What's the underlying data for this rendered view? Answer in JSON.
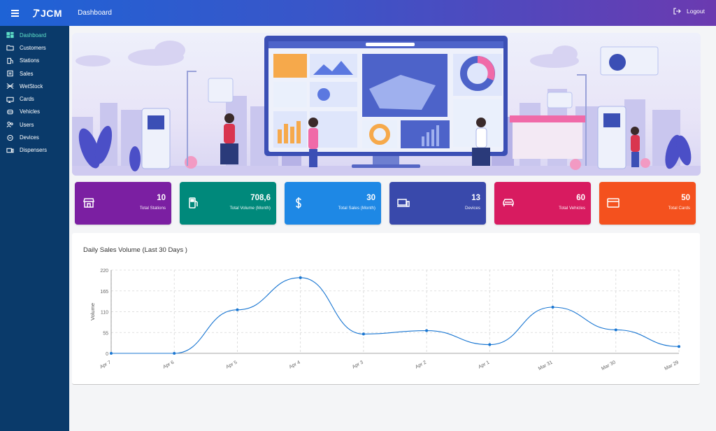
{
  "app": {
    "logo_text": "JCM",
    "page_title": "Dashboard",
    "logout_label": "Logout"
  },
  "sidebar": {
    "items": [
      {
        "label": "Dashboard",
        "icon": "dashboard-icon",
        "active": true
      },
      {
        "label": "Customers",
        "icon": "folder-icon"
      },
      {
        "label": "Stations",
        "icon": "fuel-station-icon"
      },
      {
        "label": "Sales",
        "icon": "receipt-icon"
      },
      {
        "label": "WetStock",
        "icon": "tank-icon"
      },
      {
        "label": "Cards",
        "icon": "card-icon"
      },
      {
        "label": "Vehicles",
        "icon": "vehicle-icon"
      },
      {
        "label": "Users",
        "icon": "users-icon"
      },
      {
        "label": "Devices",
        "icon": "devices-icon"
      },
      {
        "label": "Dispensers",
        "icon": "dispenser-icon"
      }
    ]
  },
  "stats": [
    {
      "value": "10",
      "label": "Total Stations",
      "color": "#7b1fa2",
      "icon": "store-icon"
    },
    {
      "value": "708,6",
      "label": "Total Volume (Month)",
      "color": "#00897b",
      "icon": "fuel-pump-icon"
    },
    {
      "value": "30",
      "label": "Total Sales (Month)",
      "color": "#1e88e5",
      "icon": "dollar-icon"
    },
    {
      "value": "13",
      "label": "Devices",
      "color": "#3949ab",
      "icon": "devices-icon"
    },
    {
      "value": "60",
      "label": "Total Vehicles",
      "color": "#d81b60",
      "icon": "car-icon"
    },
    {
      "value": "50",
      "label": "Total Cards",
      "color": "#f4511e",
      "icon": "credit-card-icon"
    }
  ],
  "chart_data": {
    "type": "line",
    "title": "Daily Sales Volume (Last 30 Days )",
    "ylabel": "Volume",
    "xlabel": "",
    "categories": [
      "Apr 7",
      "Apr 6",
      "Apr 5",
      "Apr 4",
      "Apr 3",
      "Apr 2",
      "Apr 1",
      "Mar 31",
      "Mar 30",
      "Mar 29"
    ],
    "series": [
      {
        "values": [
          0,
          0,
          115,
          200,
          51,
          60,
          23,
          122,
          62,
          18
        ]
      }
    ],
    "yticks": [
      0,
      55,
      110,
      165,
      220
    ],
    "ylim": [
      0,
      220
    ],
    "color": "#1976d2",
    "grid": true
  }
}
